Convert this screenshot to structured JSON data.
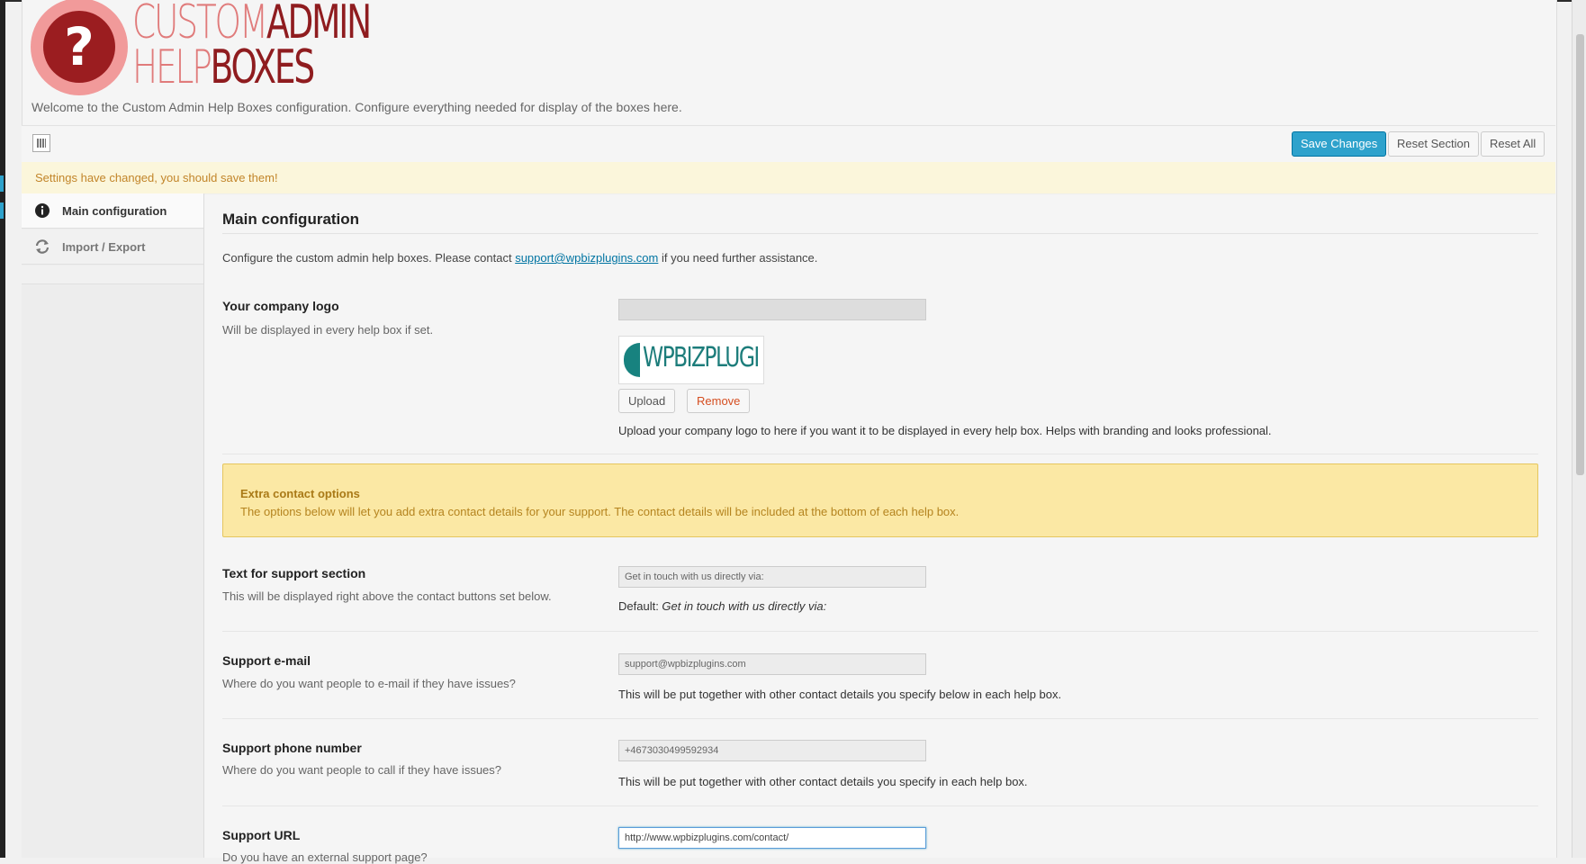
{
  "header": {
    "logo_line1_light": "CUSTOM",
    "logo_line1_dark": "ADMIN",
    "logo_line2_light": "HELP",
    "logo_line2_dark": "BOXES",
    "welcome": "Welcome to the Custom Admin Help Boxes configuration. Configure everything needed for display of the boxes here."
  },
  "toolbar": {
    "save": "Save Changes",
    "reset_section": "Reset Section",
    "reset_all": "Reset All"
  },
  "notice": "Settings have changed, you should save them!",
  "sidebar": {
    "items": [
      {
        "label": "Main configuration",
        "icon": "info-icon"
      },
      {
        "label": "Import / Export",
        "icon": "refresh-icon"
      }
    ]
  },
  "main": {
    "title": "Main configuration",
    "intro_before": "Configure the custom admin help boxes. Please contact ",
    "intro_link": "support@wpbizplugins.com",
    "intro_after": " if you need further assistance.",
    "company_logo": {
      "title": "Your company logo",
      "desc": "Will be displayed in every help box if set.",
      "preview_text": "WPBIZPLUGI",
      "upload": "Upload",
      "remove": "Remove",
      "help": "Upload your company logo to here if you want it to be displayed in every help box. Helps with branding and looks professional."
    },
    "extra_contact": {
      "title": "Extra contact options",
      "desc": "The options below will let you add extra contact details for your support. The contact details will be included at the bottom of each help box."
    },
    "support_text": {
      "title": "Text for support section",
      "desc": "This will be displayed right above the contact buttons set below.",
      "value": "Get in touch with us directly via:",
      "default_label": "Default: ",
      "default_value": "Get in touch with us directly via:"
    },
    "support_email": {
      "title": "Support e-mail",
      "desc": "Where do you want people to e-mail if they have issues?",
      "value": "support@wpbizplugins.com",
      "help": "This will be put together with other contact details you specify below in each help box."
    },
    "support_phone": {
      "title": "Support phone number",
      "desc": "Where do you want people to call if they have issues?",
      "value": "+4673030499592934",
      "help": "This will be put together with other contact details you specify in each help box."
    },
    "support_url": {
      "title": "Support URL",
      "desc": "Do you have an external support page?",
      "value": "http://www.wpbizplugins.com/contact/"
    }
  },
  "colors": {
    "primary": "#2ea2cc",
    "notice_text": "#c2852a",
    "info_bg": "#fbe8a4",
    "logo_dark": "#8f1c1f",
    "logo_light": "#e07b7b"
  }
}
